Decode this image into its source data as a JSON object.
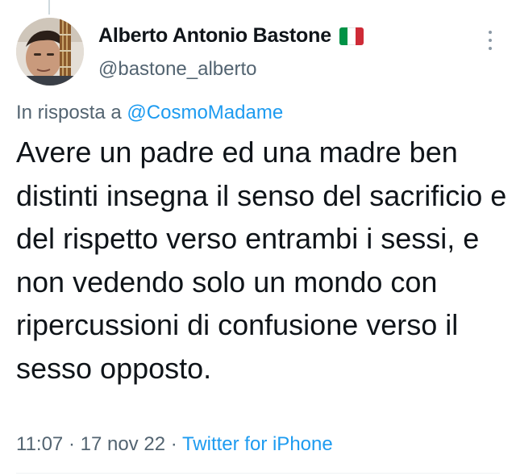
{
  "author": {
    "display_name": "Alberto Antonio Bastone",
    "handle": "@bastone_alberto",
    "avatar": "profile-photo",
    "flag_emoji": "italy-flag-icon"
  },
  "reply": {
    "prefix": "In risposta a",
    "mention": "@CosmoMadame"
  },
  "tweet": {
    "text": "Avere un padre ed una madre ben distinti insegna il senso del sacrificio e del rispetto verso entrambi i sessi, e non vedendo solo un mondo con ripercussioni di confusione verso il sesso opposto."
  },
  "meta": {
    "time": "11:07",
    "date": "17 nov 22",
    "separator": "·",
    "source": "Twitter for iPhone"
  },
  "colors": {
    "text": "#0f1419",
    "secondary": "#536471",
    "link": "#1d9bf0",
    "flag_green": "#009246",
    "flag_white": "#ffffff",
    "flag_red": "#ce2b37"
  },
  "icons": {
    "more": "more-vertical-icon"
  }
}
